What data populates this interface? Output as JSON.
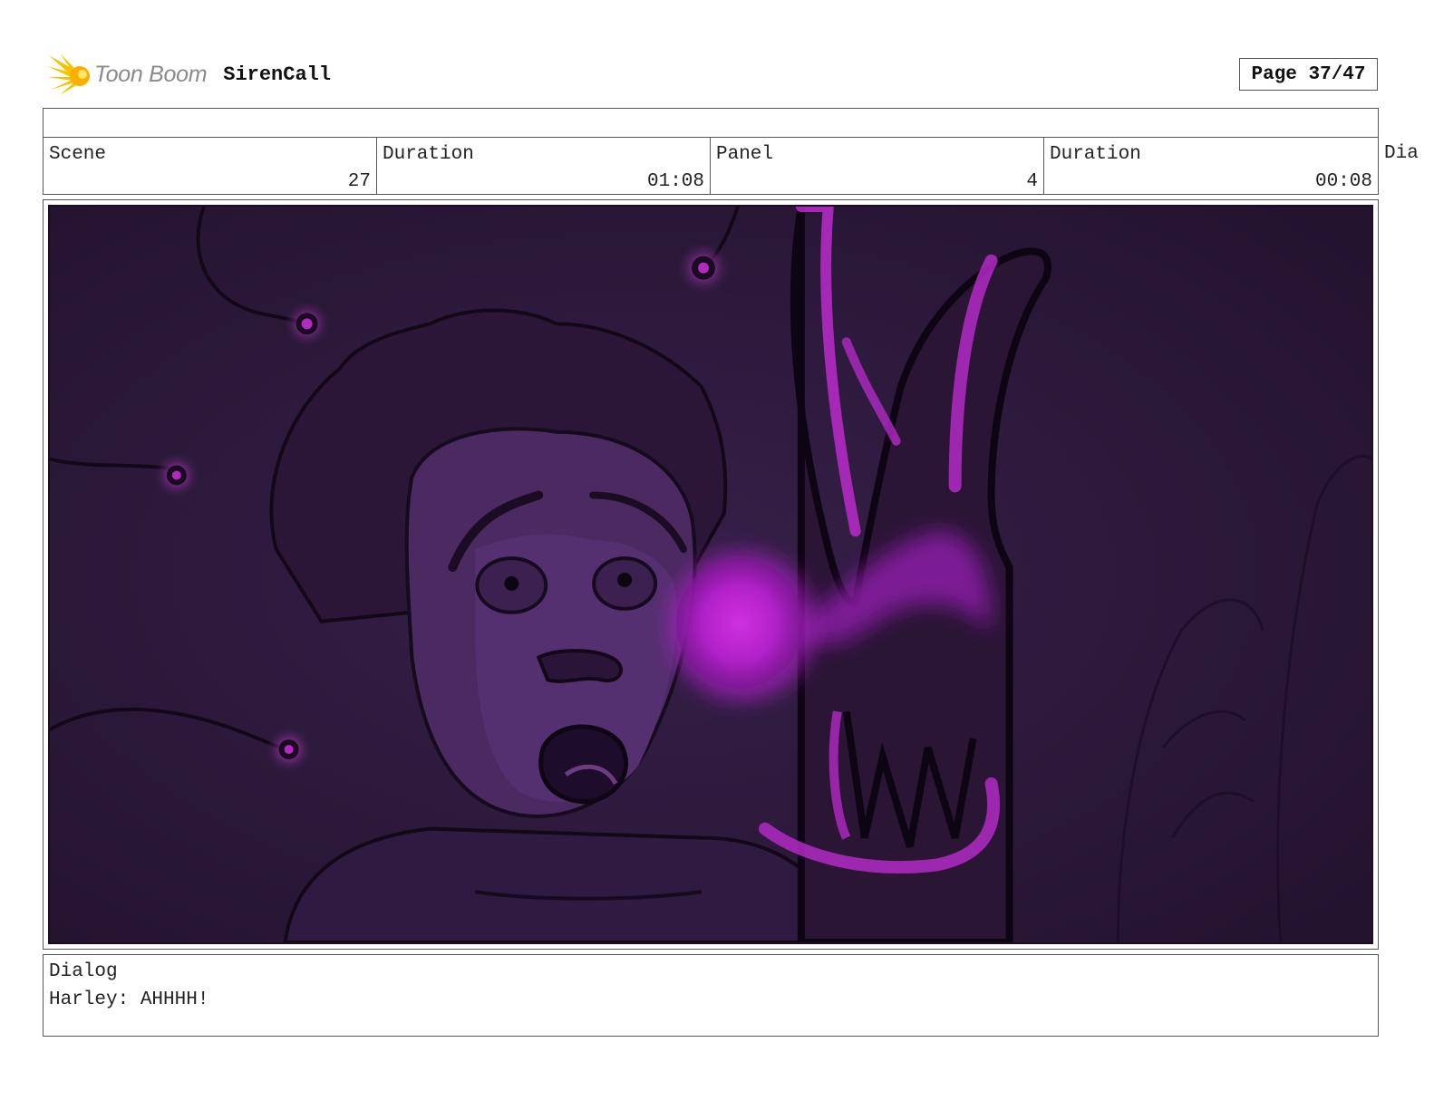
{
  "header": {
    "logo_text": "Toon Boom",
    "project_title": "SirenCall",
    "page_label": "Page 37/47"
  },
  "info": {
    "scene_label": "Scene",
    "scene_value": "27",
    "scene_duration_label": "Duration",
    "scene_duration_value": "01:08",
    "panel_label": "Panel",
    "panel_value": "4",
    "panel_duration_label": "Duration",
    "panel_duration_value": "00:08",
    "overflow_label": "Dia"
  },
  "dialog": {
    "label": "Dialog",
    "text": "Harley: AHHHH!"
  },
  "colors": {
    "panel_background": "#2e1a3f",
    "glow_magenta": "#c324d0",
    "logo_yellow": "#f5c400"
  }
}
